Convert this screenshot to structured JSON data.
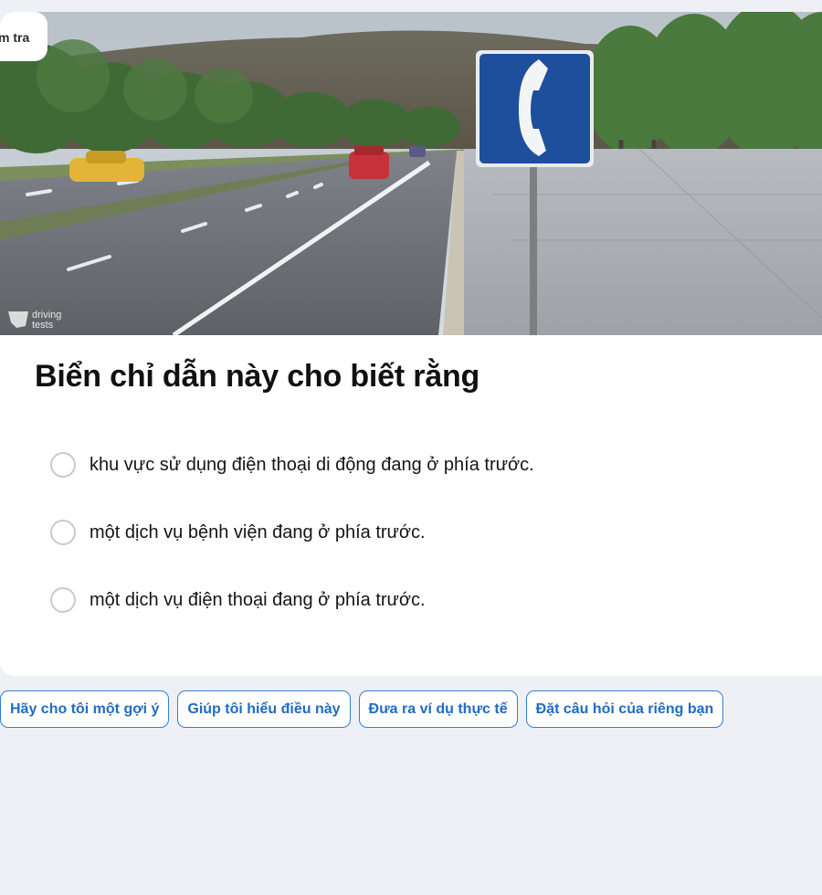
{
  "quiz_badge": {
    "label": "m tra"
  },
  "image": {
    "watermark_line1": "driving",
    "watermark_line2": "tests",
    "sign_icon": "phone-icon",
    "sign_color": "#1e4f9c"
  },
  "question": {
    "text": "Biển chỉ dẫn này cho biết rằng"
  },
  "options": [
    {
      "label": "khu vực sử dụng điện thoại di động đang ở phía trước."
    },
    {
      "label": "một dịch vụ bệnh viện đang ở phía trước."
    },
    {
      "label": "một dịch vụ điện thoại đang ở phía trước."
    }
  ],
  "suggestions": [
    {
      "label": "Hãy cho tôi một gợi ý"
    },
    {
      "label": "Giúp tôi hiểu điều này"
    },
    {
      "label": "Đưa ra ví dụ thực tế"
    },
    {
      "label": "Đặt câu hỏi của riêng bạn"
    }
  ],
  "colors": {
    "accent": "#2f7fd6",
    "background": "#eff0f5",
    "card": "#ffffff"
  }
}
